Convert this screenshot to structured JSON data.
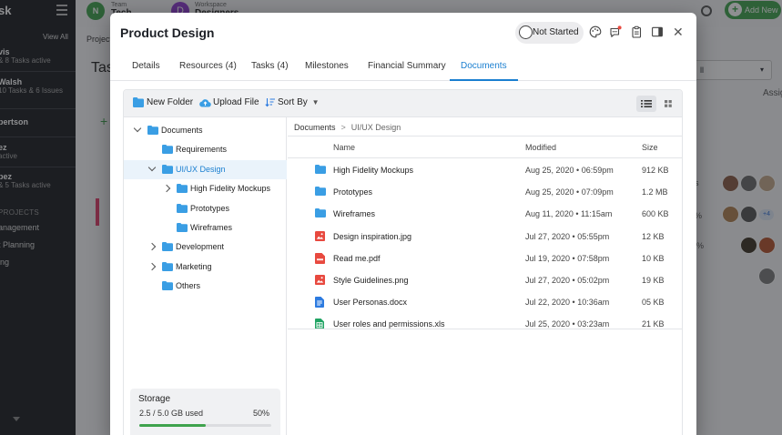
{
  "background": {
    "sidebar": {
      "brand": "sk",
      "view_all": "View All",
      "people": [
        {
          "name": "vis",
          "sub": "& 8 Tasks active"
        },
        {
          "name": "Walsh",
          "sub": "10 Tasks & 6 Issues"
        },
        {
          "name": "pertson",
          "sub": ""
        },
        {
          "name": "ez",
          "sub": "active"
        },
        {
          "name": "pez",
          "sub": "& 5 Tasks active"
        }
      ],
      "section": "PROJECTS",
      "projects": [
        "anagement",
        "t Planning",
        "ing"
      ]
    },
    "topbar": {
      "logo": "N",
      "team_caption": "Team",
      "team_name": "Tech",
      "workspace_initial": "D",
      "workspace_caption": "Workspace",
      "workspace_name": "Designers",
      "add_new": "Add New"
    },
    "main": {
      "projects_link": "Project",
      "tasks_heading": "Tas",
      "assign_label": "Assig",
      "select_value": "ll",
      "count_badge": "+4",
      "pct_labels": [
        "s",
        "%",
        "%"
      ]
    }
  },
  "modal": {
    "title": "Product Design",
    "status": "Not Started",
    "tabs": [
      {
        "label": "Details",
        "active": false
      },
      {
        "label": "Resources (4)",
        "active": false
      },
      {
        "label": "Tasks (4)",
        "active": false
      },
      {
        "label": "Milestones",
        "active": false
      },
      {
        "label": "Financial Summary",
        "active": false
      },
      {
        "label": "Documents",
        "active": true
      }
    ],
    "toolbar": {
      "new_folder": "New Folder",
      "upload_file": "Upload File",
      "sort_by": "Sort By"
    },
    "tree": [
      {
        "label": "Documents",
        "level": 0,
        "chevron": "down",
        "selected": false
      },
      {
        "label": "Requirements",
        "level": 1,
        "chevron": "",
        "selected": false
      },
      {
        "label": "UI/UX Design",
        "level": 1,
        "chevron": "down",
        "selected": true
      },
      {
        "label": "High Fidelity Mockups",
        "level": 2,
        "chevron": "right",
        "selected": false
      },
      {
        "label": "Prototypes",
        "level": 2,
        "chevron": "",
        "selected": false
      },
      {
        "label": "Wireframes",
        "level": 2,
        "chevron": "",
        "selected": false
      },
      {
        "label": "Development",
        "level": 1,
        "chevron": "right",
        "selected": false
      },
      {
        "label": "Marketing",
        "level": 1,
        "chevron": "right",
        "selected": false
      },
      {
        "label": "Others",
        "level": 1,
        "chevron": "",
        "selected": false
      }
    ],
    "storage": {
      "title": "Storage",
      "used": "2.5 / 5.0 GB  used",
      "percent_label": "50%",
      "fraction": 0.5
    },
    "breadcrumb": [
      "Documents",
      "UI/UX Design"
    ],
    "columns": {
      "name": "Name",
      "modified": "Modified",
      "size": "Size"
    },
    "files": [
      {
        "name": "High Fidelity Mockups",
        "type": "folder",
        "modified": "Aug 25, 2020 • 06:59pm",
        "size": "912 KB"
      },
      {
        "name": "Prototypes",
        "type": "folder",
        "modified": "Aug 25, 2020 • 07:09pm",
        "size": "1.2 MB"
      },
      {
        "name": "Wireframes",
        "type": "folder",
        "modified": "Aug 11, 2020 • 11:15am",
        "size": "600 KB"
      },
      {
        "name": "Design inspiration.jpg",
        "type": "image",
        "modified": "Jul 27, 2020 • 05:55pm",
        "size": "12 KB"
      },
      {
        "name": "Read me.pdf",
        "type": "pdf",
        "modified": "Jul 19, 2020 • 07:58pm",
        "size": "10 KB"
      },
      {
        "name": "Style Guidelines.png",
        "type": "image",
        "modified": "Jul 27, 2020 • 05:02pm",
        "size": "19 KB"
      },
      {
        "name": "User Personas.docx",
        "type": "doc",
        "modified": "Jul 22, 2020 • 10:36am",
        "size": "05 KB"
      },
      {
        "name": "User roles and permissions.xls",
        "type": "sheet",
        "modified": "Jul 25, 2020 • 03:23am",
        "size": "21 KB"
      }
    ]
  },
  "colors": {
    "accent": "#1a7fd0",
    "folder": "#3a9ee4",
    "image": "#e8493f",
    "pdf": "#e8493f",
    "doc": "#2d7be0",
    "sheet": "#21a464",
    "storage_fill": "#3fa34d"
  }
}
